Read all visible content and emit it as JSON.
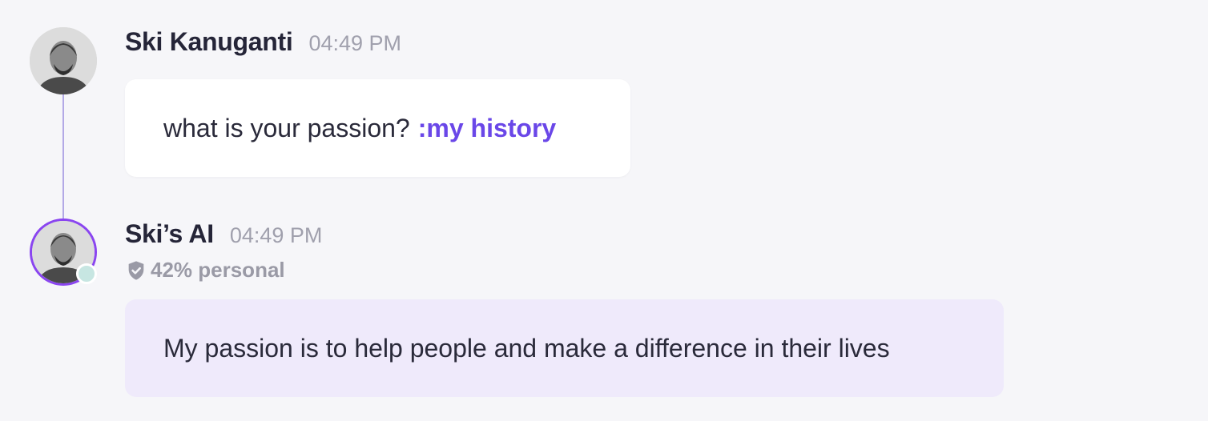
{
  "messages": [
    {
      "sender": "Ski Kanuganti",
      "time": "04:49 PM",
      "text": "what is your passion?",
      "mention": ":my history"
    },
    {
      "sender": "Ski’s AI",
      "time": "04:49 PM",
      "personal_label": "42% personal",
      "personal_icon": "shield-check-icon",
      "text": "My passion is to help people and make a difference in their lives"
    }
  ],
  "colors": {
    "background": "#f6f6f9",
    "mention": "#6a47e8",
    "ai_avatar_ring": "#8a45f0",
    "ai_bubble": "#efeafb",
    "status_dot": "#c7e6e2",
    "connector": "#b3a9e6"
  }
}
